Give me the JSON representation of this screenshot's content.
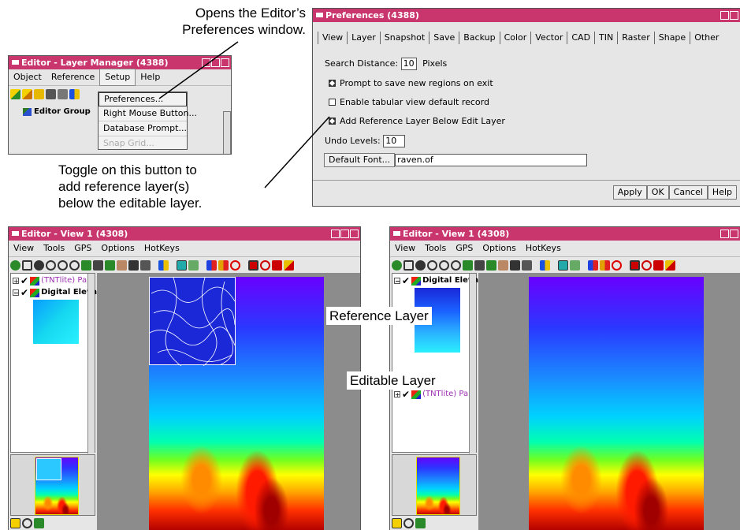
{
  "annotations": {
    "opens_line1": "Opens the Editor’s",
    "opens_line2": "Preferences window.",
    "toggle_line1": "Toggle on this button to",
    "toggle_line2": "add reference layer(s)",
    "toggle_line3": "below the editable layer.",
    "reference_layer": "Reference Layer",
    "editable_layer": "Editable Layer"
  },
  "layer_manager": {
    "title": "Editor - Layer Manager (4388)",
    "menus": [
      "Object",
      "Reference",
      "Setup",
      "Help"
    ],
    "group_label": "Editor Group",
    "setup_menu": {
      "items": [
        "Preferences...",
        "Right Mouse Button...",
        "Database Prompt...",
        "Snap Grid..."
      ],
      "disabled_item": "Snap Grid..."
    }
  },
  "preferences": {
    "title": "Preferences (4388)",
    "tabs": [
      "View",
      "Layer",
      "Snapshot",
      "Save",
      "Backup",
      "Color",
      "Vector",
      "CAD",
      "TIN",
      "Raster",
      "Shape",
      "Other"
    ],
    "search_distance_label": "Search Distance:",
    "search_distance_value": "10",
    "search_distance_units": "Pixels",
    "prompt_save_label": "Prompt to save new regions on exit",
    "prompt_save_checked": true,
    "tabular_label": "Enable tabular view default record",
    "tabular_checked": false,
    "add_ref_label": "Add Reference Layer Below Edit Layer",
    "add_ref_checked": true,
    "undo_label": "Undo Levels:",
    "undo_value": "10",
    "font_button": "Default Font...",
    "font_value": "raven.of",
    "buttons": [
      "Apply",
      "OK",
      "Cancel",
      "Help"
    ]
  },
  "view_left": {
    "title": "Editor - View 1 (4308)",
    "menus": [
      "View",
      "Tools",
      "GPS",
      "Options",
      "HotKeys"
    ],
    "layers": [
      "(TNTlite) Par",
      "Digital Eleva"
    ]
  },
  "view_right": {
    "title": "Editor - View 1 (4308)",
    "menus": [
      "View",
      "Tools",
      "GPS",
      "Options",
      "HotKeys"
    ],
    "layers": [
      "Digital Eleva",
      "(TNTlite) Par"
    ]
  },
  "colors": {
    "titlebar": "#c9366e",
    "window_bg": "#e6e6e6",
    "layer_text_purple": "#9b2fb0"
  }
}
